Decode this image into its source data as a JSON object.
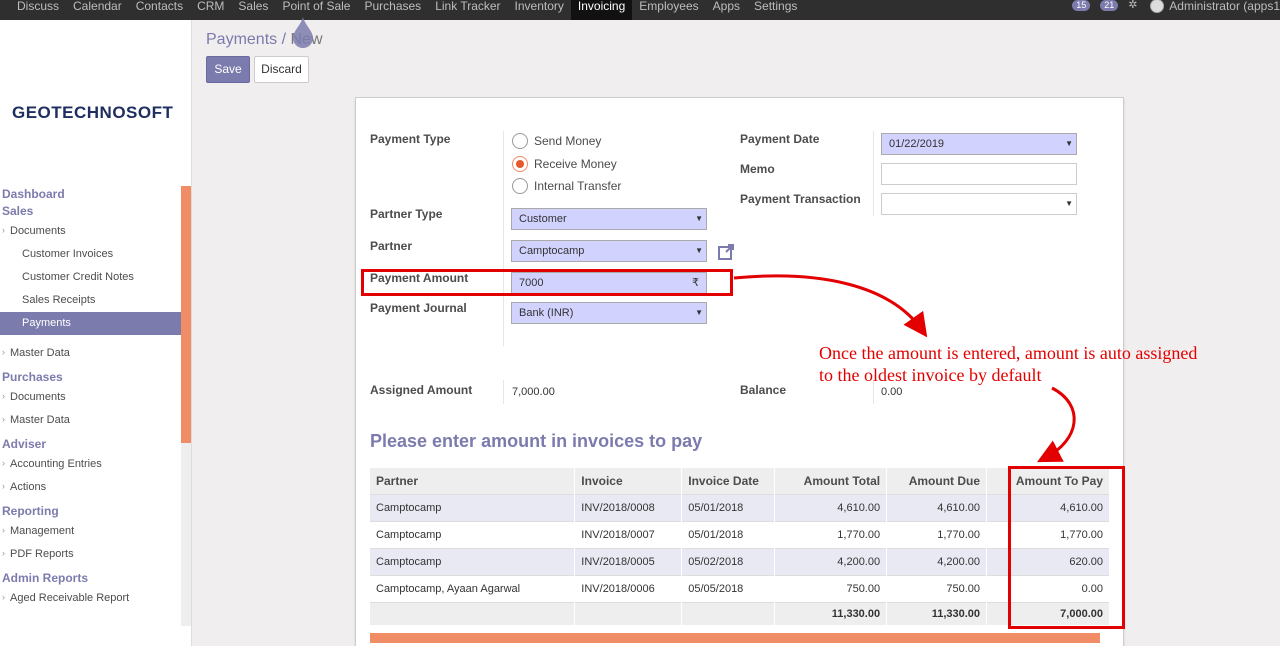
{
  "topbar": {
    "menu": [
      "Discuss",
      "Calendar",
      "Contacts",
      "CRM",
      "Sales",
      "Point of Sale",
      "Purchases",
      "Link Tracker",
      "Inventory",
      "Invoicing",
      "Employees",
      "Apps",
      "Settings"
    ],
    "active_menu": "Invoicing",
    "messages_badge": "15",
    "activities_badge": "21",
    "user": "Administrator (apps1"
  },
  "sidebar": {
    "logo": "GEOTECHNOSOFT",
    "sections": [
      {
        "title": "Dashboard",
        "items": []
      },
      {
        "title": "Sales",
        "items": [
          {
            "label": "Documents",
            "level": 1
          },
          {
            "label": "Customer Invoices",
            "level": 2
          },
          {
            "label": "Customer Credit Notes",
            "level": 2
          },
          {
            "label": "Sales Receipts",
            "level": 2
          },
          {
            "label": "Payments",
            "level": 2,
            "active": true
          },
          {
            "label": "Master Data",
            "level": 1
          }
        ]
      },
      {
        "title": "Purchases",
        "items": [
          {
            "label": "Documents",
            "level": 1
          },
          {
            "label": "Master Data",
            "level": 1
          }
        ]
      },
      {
        "title": "Adviser",
        "items": [
          {
            "label": "Accounting Entries",
            "level": 1
          },
          {
            "label": "Actions",
            "level": 1
          }
        ]
      },
      {
        "title": "Reporting",
        "items": [
          {
            "label": "Management",
            "level": 1
          },
          {
            "label": "PDF Reports",
            "level": 1
          }
        ]
      },
      {
        "title": "Admin Reports",
        "items": [
          {
            "label": "Aged Receivable Report",
            "level": 1
          }
        ]
      }
    ]
  },
  "breadcrumb": {
    "parent": "Payments",
    "separator": "/",
    "current": "New"
  },
  "buttons": {
    "save": "Save",
    "discard": "Discard"
  },
  "form": {
    "payment_type_label": "Payment Type",
    "payment_type_options": [
      "Send Money",
      "Receive Money",
      "Internal Transfer"
    ],
    "payment_type_selected": "Receive Money",
    "partner_type_label": "Partner Type",
    "partner_type": "Customer",
    "partner_label": "Partner",
    "partner": "Camptocamp",
    "payment_amount_label": "Payment Amount",
    "payment_amount": "7000",
    "currency_symbol": "₹",
    "payment_journal_label": "Payment Journal",
    "payment_journal": "Bank (INR)",
    "payment_date_label": "Payment Date",
    "payment_date": "01/22/2019",
    "memo_label": "Memo",
    "memo": "",
    "payment_transaction_label": "Payment Transaction",
    "payment_transaction": "",
    "assigned_amount_label": "Assigned Amount",
    "assigned_amount": "7,000.00",
    "balance_label": "Balance",
    "balance": "0.00",
    "section_title": "Please enter amount in invoices to pay"
  },
  "invoice_table": {
    "columns": [
      "Partner",
      "Invoice",
      "Invoice Date",
      "Amount Total",
      "Amount Due",
      "Amount To Pay"
    ],
    "rows": [
      [
        "Camptocamp",
        "INV/2018/0008",
        "05/01/2018",
        "4,610.00",
        "4,610.00",
        "4,610.00"
      ],
      [
        "Camptocamp",
        "INV/2018/0007",
        "05/01/2018",
        "1,770.00",
        "1,770.00",
        "1,770.00"
      ],
      [
        "Camptocamp",
        "INV/2018/0005",
        "05/02/2018",
        "4,200.00",
        "4,200.00",
        "620.00"
      ],
      [
        "Camptocamp, Ayaan Agarwal",
        "INV/2018/0006",
        "05/05/2018",
        "750.00",
        "750.00",
        "0.00"
      ]
    ],
    "totals": [
      "",
      "",
      "",
      "11,330.00",
      "11,330.00",
      "7,000.00"
    ]
  },
  "annotation": {
    "line1": "Once the amount is entered, amount is auto assigned",
    "line2": "to the oldest invoice by default"
  },
  "colors": {
    "brand": "#7c7bad",
    "accent": "#f08c66",
    "annotation_red": "#e30000",
    "topbar": "#2f2f2f"
  }
}
